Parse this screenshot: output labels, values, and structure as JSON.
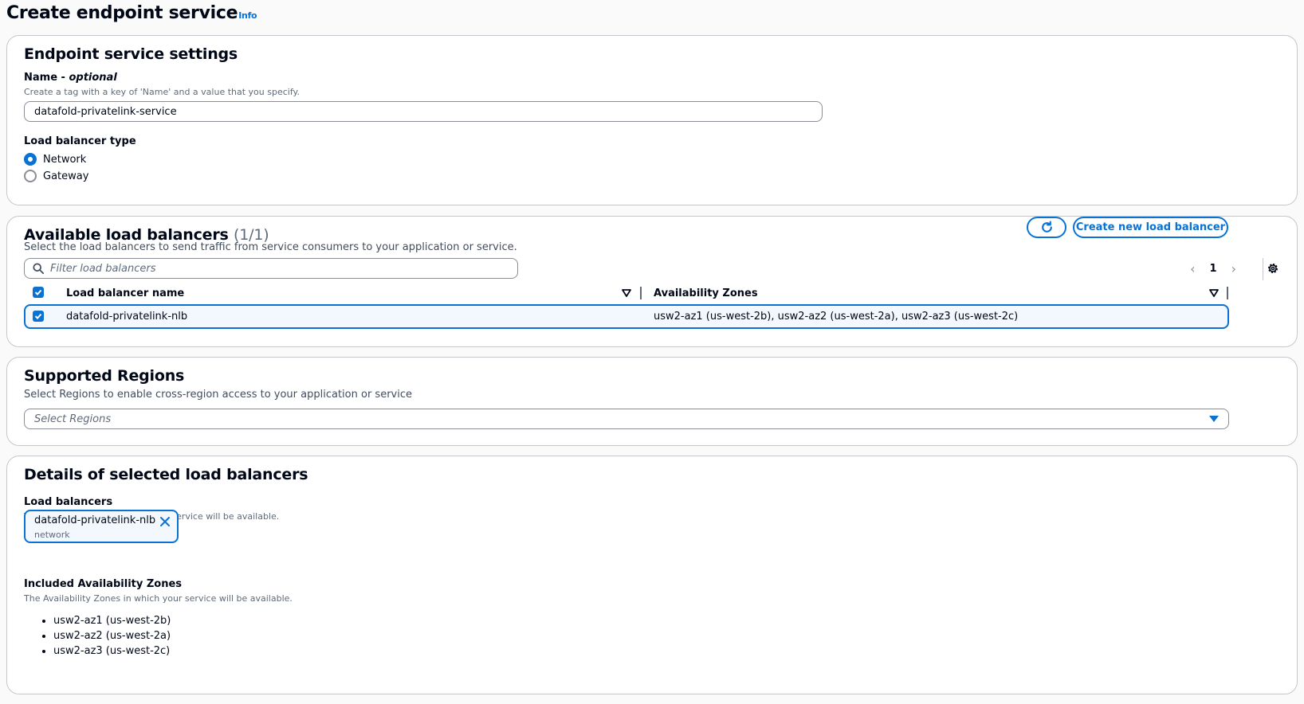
{
  "page": {
    "title": "Create endpoint service",
    "info_link": "Info"
  },
  "settings": {
    "heading": "Endpoint service settings",
    "name_label": "Name - ",
    "name_optional": "optional",
    "name_description": "Create a tag with a key of 'Name' and a value that you specify.",
    "name_value": "datafold-privatelink-service",
    "lb_type_label": "Load balancer type",
    "lb_type_options": [
      "Network",
      "Gateway"
    ],
    "lb_type_selected": "Network"
  },
  "load_balancers": {
    "heading": "Available load balancers",
    "count": "(1/1)",
    "description": "Select the load balancers to send traffic from service consumers to your application or service.",
    "refresh_icon": "refresh-icon",
    "create_button": "Create new load balancer",
    "filter_placeholder": "Filter load balancers",
    "page_number": "1",
    "columns": [
      "Load balancer name",
      "Availability Zones"
    ],
    "rows": [
      {
        "name": "datafold-privatelink-nlb",
        "zones": "usw2-az1 (us-west-2b), usw2-az2 (us-west-2a), usw2-az3 (us-west-2c)",
        "selected": true
      }
    ]
  },
  "regions": {
    "heading": "Supported Regions",
    "description": "Select Regions to enable cross-region access to your application or service",
    "placeholder": "Select Regions"
  },
  "details": {
    "heading": "Details of selected load balancers",
    "lb_label": "Load balancers",
    "lb_description": "The load balancers in which your service will be available.",
    "token_name": "datafold-privatelink-nlb",
    "token_type": "network",
    "az_label": "Included Availability Zones",
    "az_description": "The Availability Zones in which your service will be available.",
    "az_items": [
      "usw2-az1 (us-west-2b)",
      "usw2-az2 (us-west-2a)",
      "usw2-az3 (us-west-2c)"
    ]
  },
  "colors": {
    "accent": "#0972d3",
    "border": "#c6c6cd",
    "text": "#000716"
  }
}
